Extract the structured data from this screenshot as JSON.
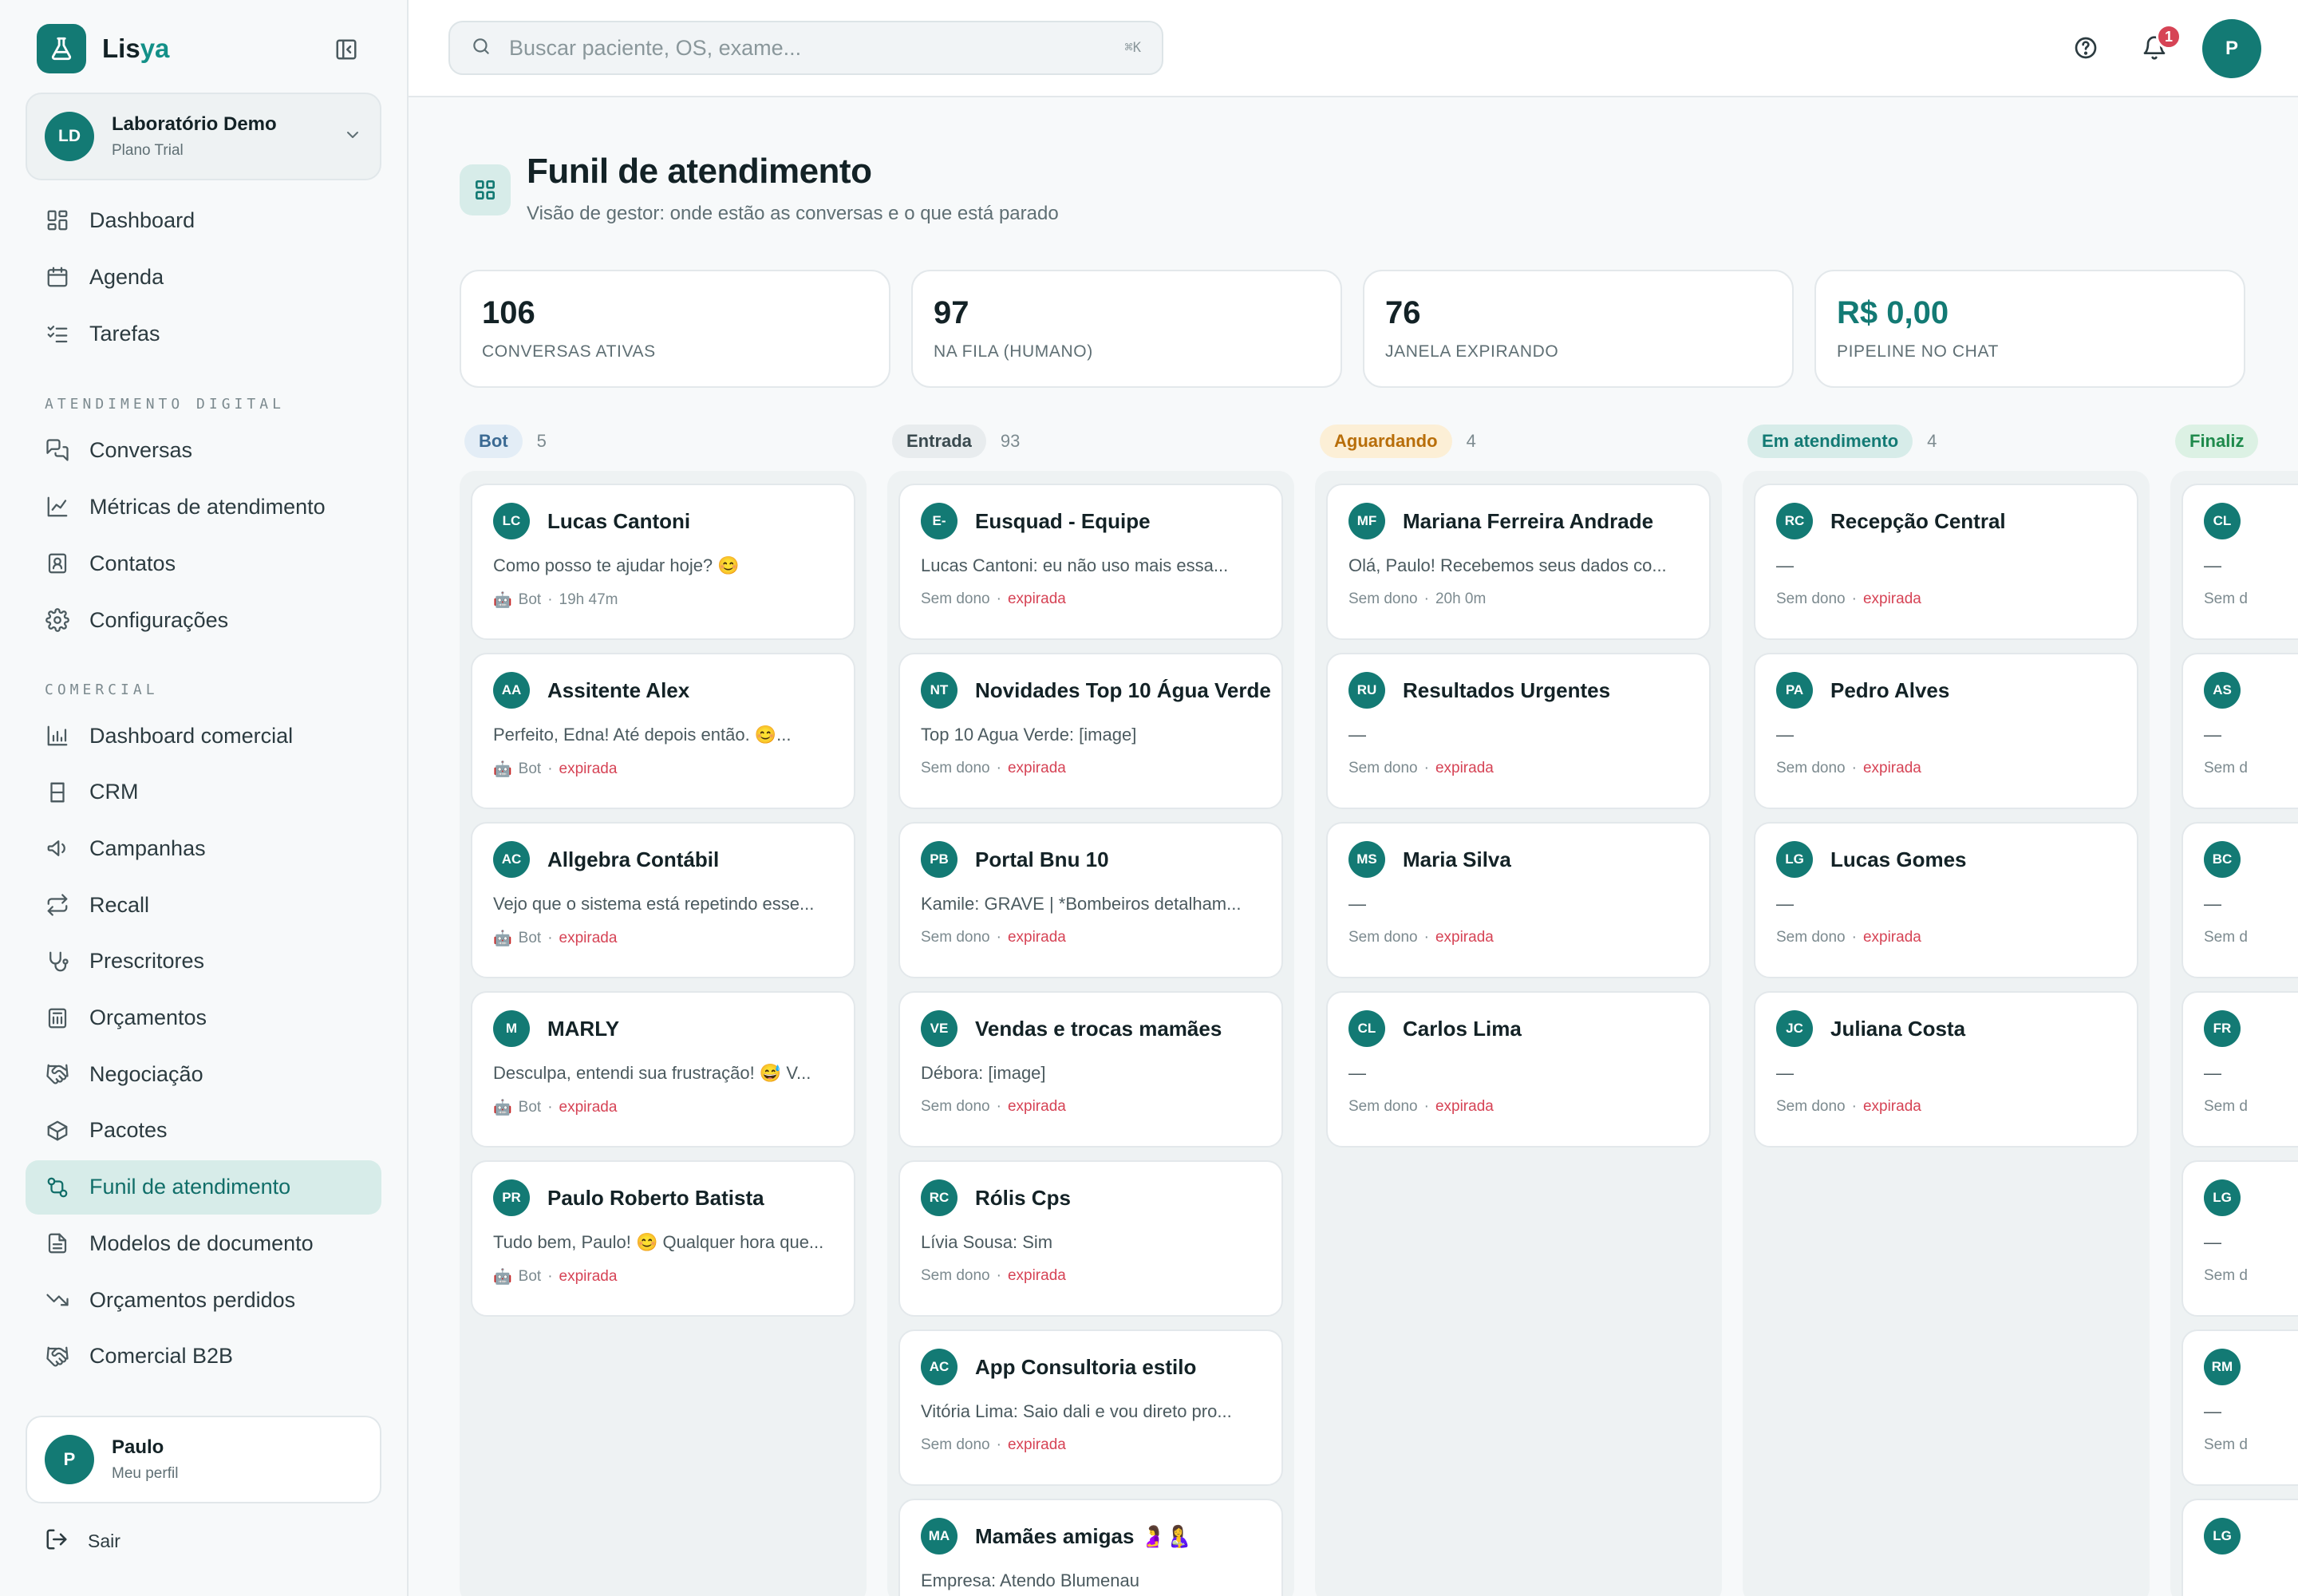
{
  "brand": {
    "name_main": "Lis",
    "name_accent": "ya"
  },
  "org": {
    "initials": "LD",
    "name": "Laboratório Demo",
    "plan": "Plano Trial"
  },
  "nav": {
    "top": [
      {
        "label": "Dashboard",
        "icon": "dashboard-icon"
      },
      {
        "label": "Agenda",
        "icon": "calendar-icon"
      },
      {
        "label": "Tarefas",
        "icon": "checklist-icon"
      }
    ],
    "section1": "ATENDIMENTO DIGITAL",
    "digital": [
      {
        "label": "Conversas",
        "icon": "chat-icon"
      },
      {
        "label": "Métricas de atendimento",
        "icon": "line-chart-icon"
      },
      {
        "label": "Contatos",
        "icon": "contact-icon"
      },
      {
        "label": "Configurações",
        "icon": "gear-icon"
      }
    ],
    "section2": "COMERCIAL",
    "commercial": [
      {
        "label": "Dashboard comercial",
        "icon": "bar-chart-icon"
      },
      {
        "label": "CRM",
        "icon": "crm-icon"
      },
      {
        "label": "Campanhas",
        "icon": "megaphone-icon"
      },
      {
        "label": "Recall",
        "icon": "repeat-icon"
      },
      {
        "label": "Prescritores",
        "icon": "stethoscope-icon"
      },
      {
        "label": "Orçamentos",
        "icon": "calculator-icon"
      },
      {
        "label": "Negociação",
        "icon": "handshake-icon"
      },
      {
        "label": "Pacotes",
        "icon": "package-icon"
      },
      {
        "label": "Funil de atendimento",
        "icon": "funnel-icon",
        "active": true
      },
      {
        "label": "Modelos de documento",
        "icon": "document-icon"
      },
      {
        "label": "Orçamentos perdidos",
        "icon": "trending-down-icon"
      },
      {
        "label": "Comercial B2B",
        "icon": "handshake-icon"
      }
    ]
  },
  "user": {
    "initial": "P",
    "name": "Paulo",
    "sub": "Meu perfil",
    "logout": "Sair"
  },
  "topbar": {
    "search_placeholder": "Buscar paciente, OS, exame...",
    "shortcut": "⌘K",
    "notifications": "1",
    "avatar": "P"
  },
  "page": {
    "title": "Funil de atendimento",
    "subtitle": "Visão de gestor: onde estão as conversas e o que está parado"
  },
  "stats": [
    {
      "value": "106",
      "label": "CONVERSAS ATIVAS"
    },
    {
      "value": "97",
      "label": "NA FILA (HUMANO)"
    },
    {
      "value": "76",
      "label": "JANELA EXPIRANDO"
    },
    {
      "value": "R$ 0,00",
      "label": "PIPELINE NO CHAT",
      "accent": true
    }
  ],
  "columns": [
    {
      "title": "Bot",
      "count": "5",
      "pill_bg": "#e3edf6",
      "pill_fg": "#3b6a93",
      "cards": [
        {
          "initials": "LC",
          "name": "Lucas Cantoni",
          "msg": "Como posso te ajudar hoje? 😊",
          "owner": "Bot",
          "status": "19h 47m",
          "expired": false,
          "bot": true
        },
        {
          "initials": "AA",
          "name": "Assitente Alex",
          "msg": "Perfeito, Edna! Até depois então. 😊...",
          "owner": "Bot",
          "status": "expirada",
          "expired": true,
          "bot": true
        },
        {
          "initials": "AC",
          "name": "Allgebra Contábil",
          "msg": "Vejo que o sistema está repetindo esse...",
          "owner": "Bot",
          "status": "expirada",
          "expired": true,
          "bot": true
        },
        {
          "initials": "M",
          "name": "MARLY",
          "msg": "Desculpa, entendi sua frustração! 😅 V...",
          "owner": "Bot",
          "status": "expirada",
          "expired": true,
          "bot": true
        },
        {
          "initials": "PR",
          "name": "Paulo Roberto Batista",
          "msg": "Tudo bem, Paulo! 😊 Qualquer hora que...",
          "owner": "Bot",
          "status": "expirada",
          "expired": true,
          "bot": true
        }
      ]
    },
    {
      "title": "Entrada",
      "count": "93",
      "pill_bg": "#e8ecee",
      "pill_fg": "#3a4a4f",
      "cards": [
        {
          "initials": "E-",
          "name": "Eusquad - Equipe",
          "msg": "Lucas Cantoni: eu não uso mais essa...",
          "owner": "Sem dono",
          "status": "expirada",
          "expired": true
        },
        {
          "initials": "NT",
          "name": "Novidades Top 10 Água Verde",
          "msg": "Top 10 Agua Verde: [image]",
          "owner": "Sem dono",
          "status": "expirada",
          "expired": true
        },
        {
          "initials": "PB",
          "name": "Portal Bnu 10",
          "msg": "Kamile: GRAVE | *Bombeiros detalham...",
          "owner": "Sem dono",
          "status": "expirada",
          "expired": true
        },
        {
          "initials": "VE",
          "name": "Vendas e trocas mamães",
          "msg": "Débora: [image]",
          "owner": "Sem dono",
          "status": "expirada",
          "expired": true
        },
        {
          "initials": "RC",
          "name": "Rólis Cps",
          "msg": "Lívia Sousa: Sim",
          "owner": "Sem dono",
          "status": "expirada",
          "expired": true
        },
        {
          "initials": "AC",
          "name": "App Consultoria estilo",
          "msg": "Vitória Lima: Saio dali e vou direto pro...",
          "owner": "Sem dono",
          "status": "expirada",
          "expired": true
        },
        {
          "initials": "MA",
          "name": "Mamães amigas 🤰🤱",
          "msg": "Empresa: Atendo Blumenau",
          "owner": "Sem dono",
          "status": "expirada",
          "expired": true
        }
      ]
    },
    {
      "title": "Aguardando",
      "count": "4",
      "pill_bg": "#fcefd6",
      "pill_fg": "#b86e0a",
      "cards": [
        {
          "initials": "MF",
          "name": "Mariana Ferreira Andrade",
          "msg": "Olá, Paulo! Recebemos seus dados co...",
          "owner": "Sem dono",
          "status": "20h 0m",
          "expired": false
        },
        {
          "initials": "RU",
          "name": "Resultados Urgentes",
          "msg": "—",
          "owner": "Sem dono",
          "status": "expirada",
          "expired": true
        },
        {
          "initials": "MS",
          "name": "Maria Silva",
          "msg": "—",
          "owner": "Sem dono",
          "status": "expirada",
          "expired": true
        },
        {
          "initials": "CL",
          "name": "Carlos Lima",
          "msg": "—",
          "owner": "Sem dono",
          "status": "expirada",
          "expired": true
        }
      ]
    },
    {
      "title": "Em atendimento",
      "count": "4",
      "pill_bg": "#d7ece9",
      "pill_fg": "#137a74",
      "cards": [
        {
          "initials": "RC",
          "name": "Recepção Central",
          "msg": "—",
          "owner": "Sem dono",
          "status": "expirada",
          "expired": true
        },
        {
          "initials": "PA",
          "name": "Pedro Alves",
          "msg": "—",
          "owner": "Sem dono",
          "status": "expirada",
          "expired": true
        },
        {
          "initials": "LG",
          "name": "Lucas Gomes",
          "msg": "—",
          "owner": "Sem dono",
          "status": "expirada",
          "expired": true
        },
        {
          "initials": "JC",
          "name": "Juliana Costa",
          "msg": "—",
          "owner": "Sem dono",
          "status": "expirada",
          "expired": true
        }
      ]
    },
    {
      "title": "Finaliz",
      "count": "",
      "pill_bg": "#dcf1e4",
      "pill_fg": "#1f8a4c",
      "cards": [
        {
          "initials": "CL",
          "name": "",
          "msg": "—",
          "owner": "Sem d",
          "status": "",
          "expired": false
        },
        {
          "initials": "AS",
          "name": "",
          "msg": "—",
          "owner": "Sem d",
          "status": "",
          "expired": false
        },
        {
          "initials": "BC",
          "name": "",
          "msg": "—",
          "owner": "Sem d",
          "status": "",
          "expired": false
        },
        {
          "initials": "FR",
          "name": "",
          "msg": "—",
          "owner": "Sem d",
          "status": "",
          "expired": false
        },
        {
          "initials": "LG",
          "name": "",
          "msg": "—",
          "owner": "Sem d",
          "status": "",
          "expired": false
        },
        {
          "initials": "RM",
          "name": "",
          "msg": "—",
          "owner": "Sem d",
          "status": "",
          "expired": false
        },
        {
          "initials": "LG",
          "name": "",
          "msg": "",
          "owner": "",
          "status": "",
          "expired": false
        }
      ]
    }
  ]
}
